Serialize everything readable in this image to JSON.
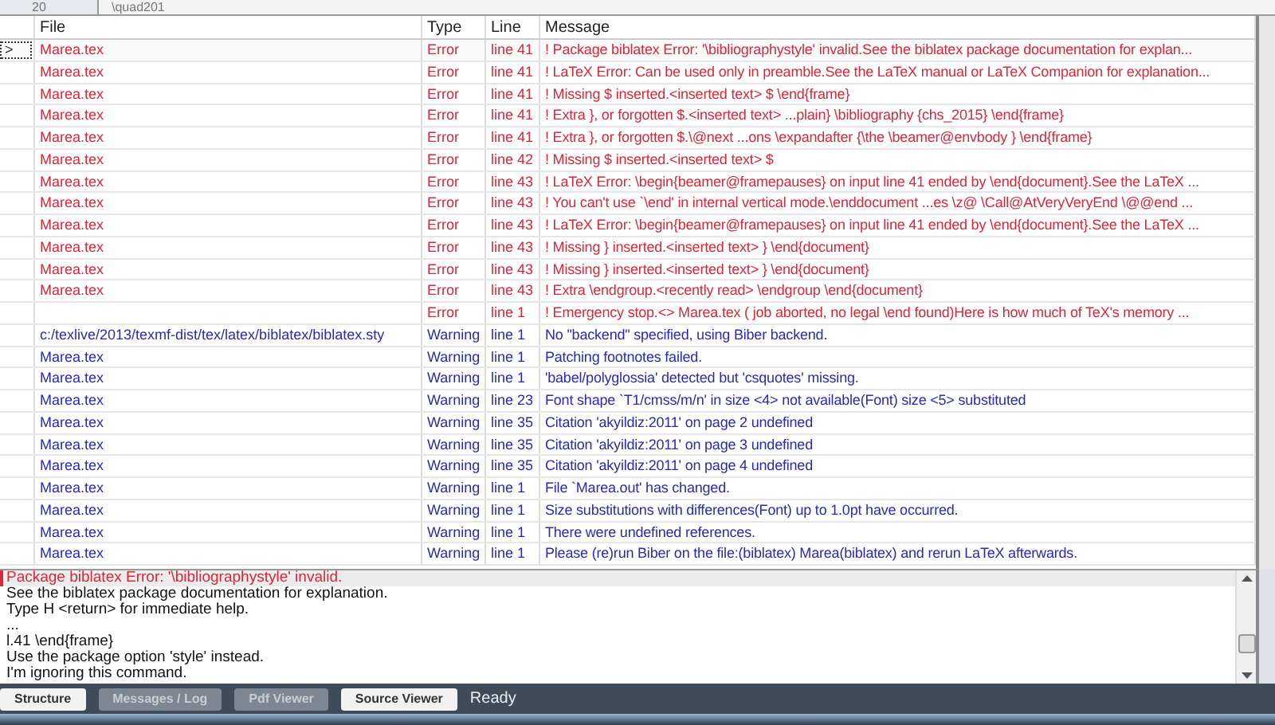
{
  "top_strip": {
    "line_number": "20",
    "text": "\\quad201"
  },
  "table": {
    "columns": [
      "File",
      "Type",
      "Line",
      "Message"
    ],
    "rows": [
      {
        "kind": "error",
        "selected": true,
        "marker": ">",
        "file": "Marea.tex",
        "type": "Error",
        "line": "line 41",
        "message": "! Package biblatex Error: '\\bibliographystyle' invalid.See the biblatex package documentation for explan..."
      },
      {
        "kind": "error",
        "selected": false,
        "file": "Marea.tex",
        "type": "Error",
        "line": "line 41",
        "message": "! LaTeX Error: Can be used only in preamble.See the LaTeX manual or LaTeX Companion for explanation..."
      },
      {
        "kind": "error",
        "selected": false,
        "file": "Marea.tex",
        "type": "Error",
        "line": "line 41",
        "message": "! Missing $ inserted.<inserted text> $ \\end{frame}"
      },
      {
        "kind": "error",
        "selected": false,
        "file": "Marea.tex",
        "type": "Error",
        "line": "line 41",
        "message": "! Extra }, or forgotten $.<inserted text> ...plain} \\bibliography {chs_2015} \\end{frame}"
      },
      {
        "kind": "error",
        "selected": false,
        "file": "Marea.tex",
        "type": "Error",
        "line": "line 41",
        "message": "! Extra }, or forgotten $.\\@next ...ons \\expandafter {\\the \\beamer@envbody } \\end{frame}"
      },
      {
        "kind": "error",
        "selected": false,
        "file": "Marea.tex",
        "type": "Error",
        "line": "line 42",
        "message": "! Missing $ inserted.<inserted text> $"
      },
      {
        "kind": "error",
        "selected": false,
        "file": "Marea.tex",
        "type": "Error",
        "line": "line 43",
        "message": "! LaTeX Error: \\begin{beamer@framepauses} on input line 41 ended by \\end{document}.See the LaTeX ..."
      },
      {
        "kind": "error",
        "selected": false,
        "file": "Marea.tex",
        "type": "Error",
        "line": "line 43",
        "message": "! You can't use `\\end' in internal vertical mode.\\enddocument ...es \\z@ \\Call@AtVeryVeryEnd \\@@end ..."
      },
      {
        "kind": "error",
        "selected": false,
        "file": "Marea.tex",
        "type": "Error",
        "line": "line 43",
        "message": "! LaTeX Error: \\begin{beamer@framepauses} on input line 41 ended by \\end{document}.See the LaTeX ..."
      },
      {
        "kind": "error",
        "selected": false,
        "file": "Marea.tex",
        "type": "Error",
        "line": "line 43",
        "message": "! Missing } inserted.<inserted text> } \\end{document}"
      },
      {
        "kind": "error",
        "selected": false,
        "file": "Marea.tex",
        "type": "Error",
        "line": "line 43",
        "message": "! Missing } inserted.<inserted text> } \\end{document}"
      },
      {
        "kind": "error",
        "selected": false,
        "file": "Marea.tex",
        "type": "Error",
        "line": "line 43",
        "message": "! Extra \\endgroup.<recently read> \\endgroup \\end{document}"
      },
      {
        "kind": "error",
        "selected": false,
        "type": "Error",
        "line": "line 1",
        "message": "! Emergency stop.<> Marea.tex ( job aborted, no legal \\end found)Here is how much of TeX's memory ..."
      },
      {
        "kind": "warning",
        "selected": false,
        "file": "c:/texlive/2013/texmf-dist/tex/latex/biblatex/biblatex.sty",
        "type": "Warning",
        "line": "line 1",
        "message": "No \"backend\" specified, using Biber backend."
      },
      {
        "kind": "warning",
        "selected": false,
        "file": "Marea.tex",
        "type": "Warning",
        "line": "line 1",
        "message": "Patching footnotes failed."
      },
      {
        "kind": "warning",
        "selected": false,
        "file": "Marea.tex",
        "type": "Warning",
        "line": "line 1",
        "message": "'babel/polyglossia' detected but 'csquotes' missing."
      },
      {
        "kind": "warning",
        "selected": false,
        "file": "Marea.tex",
        "type": "Warning",
        "line": "line 23",
        "message": "Font shape `T1/cmss/m/n' in size <4> not available(Font) size <5> substituted"
      },
      {
        "kind": "warning",
        "selected": false,
        "file": "Marea.tex",
        "type": "Warning",
        "line": "line 35",
        "message": "Citation 'akyildiz:2011' on page 2 undefined"
      },
      {
        "kind": "warning",
        "selected": false,
        "file": "Marea.tex",
        "type": "Warning",
        "line": "line 35",
        "message": "Citation 'akyildiz:2011' on page 3 undefined"
      },
      {
        "kind": "warning",
        "selected": false,
        "file": "Marea.tex",
        "type": "Warning",
        "line": "line 35",
        "message": "Citation 'akyildiz:2011' on page 4 undefined"
      },
      {
        "kind": "warning",
        "selected": false,
        "file": "Marea.tex",
        "type": "Warning",
        "line": "line 1",
        "message": "File `Marea.out' has changed."
      },
      {
        "kind": "warning",
        "selected": false,
        "file": "Marea.tex",
        "type": "Warning",
        "line": "line 1",
        "message": "Size substitutions with differences(Font) up to 1.0pt have occurred."
      },
      {
        "kind": "warning",
        "selected": false,
        "file": "Marea.tex",
        "type": "Warning",
        "line": "line 1",
        "message": "There were undefined references."
      },
      {
        "kind": "warning",
        "selected": false,
        "file": "Marea.tex",
        "type": "Warning",
        "line": "line 1",
        "message": "Please (re)run Biber on the file:(biblatex) Marea(biblatex) and rerun LaTeX afterwards."
      }
    ]
  },
  "log": {
    "lines": [
      {
        "kind": "error",
        "text": "Package biblatex Error: '\\bibliographystyle' invalid."
      },
      {
        "kind": "plain",
        "text": "See the biblatex package documentation for explanation."
      },
      {
        "kind": "plain",
        "text": "Type H <return> for immediate help."
      },
      {
        "kind": "plain",
        "text": "..."
      },
      {
        "kind": "plain",
        "text": "l.41 \\end{frame}"
      },
      {
        "kind": "plain",
        "text": "Use the package option 'style' instead."
      },
      {
        "kind": "plain",
        "text": "I'm ignoring this command."
      }
    ]
  },
  "status_bar": {
    "buttons": [
      {
        "label": "Structure",
        "active": false
      },
      {
        "label": "Messages / Log",
        "active": true
      },
      {
        "label": "Pdf Viewer",
        "active": true
      },
      {
        "label": "Source Viewer",
        "active": false
      }
    ],
    "status": "Ready"
  }
}
